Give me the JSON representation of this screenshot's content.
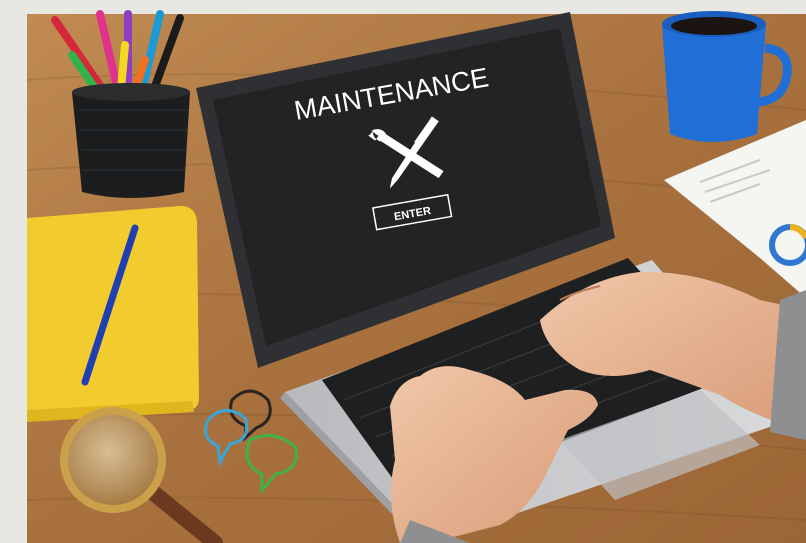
{
  "photo": {
    "screen_heading": "MAINTENANCE",
    "enter_button_label": "ENTER",
    "icon": "wrench-screwdriver-icon"
  },
  "colors": {
    "page_border": "#e9e7e1",
    "desk": "#b07a45",
    "screen": "#232324",
    "laptop_body": "#c9cacc",
    "notebook": "#f2cc2e",
    "mug": "#1f6fd6"
  }
}
